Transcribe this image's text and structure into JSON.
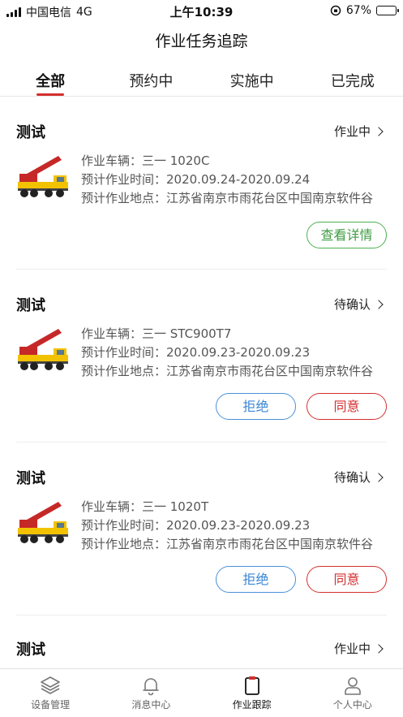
{
  "status_bar": {
    "carrier": "中国电信",
    "network": "4G",
    "time": "上午10:39",
    "battery": "67%",
    "battery_level": 0.67
  },
  "header": {
    "title": "作业任务追踪"
  },
  "tabs": [
    {
      "label": "全部",
      "active": true
    },
    {
      "label": "预约中",
      "active": false
    },
    {
      "label": "实施中",
      "active": false
    },
    {
      "label": "已完成",
      "active": false
    }
  ],
  "orders": [
    {
      "title": "测试",
      "status": "作业中",
      "vehicle": "作业车辆：三一 1020C",
      "time": "预计作业时间：2020.09.24-2020.09.24",
      "location": "预计作业地点：江苏省南京市雨花台区中国南京软件谷",
      "actions": [
        "查看详情"
      ]
    },
    {
      "title": "测试",
      "status": "待确认",
      "vehicle": "作业车辆：三一 STC900T7",
      "time": "预计作业时间：2020.09.23-2020.09.23",
      "location": "预计作业地点：江苏省南京市雨花台区中国南京软件谷",
      "actions": [
        "拒绝",
        "同意"
      ]
    },
    {
      "title": "测试",
      "status": "待确认",
      "vehicle": "作业车辆：三一 1020T",
      "time": "预计作业时间：2020.09.23-2020.09.23",
      "location": "预计作业地点：江苏省南京市雨花台区中国南京软件谷",
      "actions": [
        "拒绝",
        "同意"
      ]
    },
    {
      "title": "测试",
      "status": "作业中"
    }
  ],
  "bottom_nav": [
    {
      "label": "设备管理",
      "icon": "layers-icon",
      "active": false
    },
    {
      "label": "消息中心",
      "icon": "bell-icon",
      "active": false
    },
    {
      "label": "作业跟踪",
      "icon": "clipboard-icon",
      "active": true
    },
    {
      "label": "个人中心",
      "icon": "person-icon",
      "active": false
    }
  ],
  "colors": {
    "accent_red": "#d32f2f",
    "detail_green": "#3d9c42",
    "reject_blue": "#3a86d4",
    "crane_red": "#c62828",
    "crane_yellow": "#f2c200"
  }
}
